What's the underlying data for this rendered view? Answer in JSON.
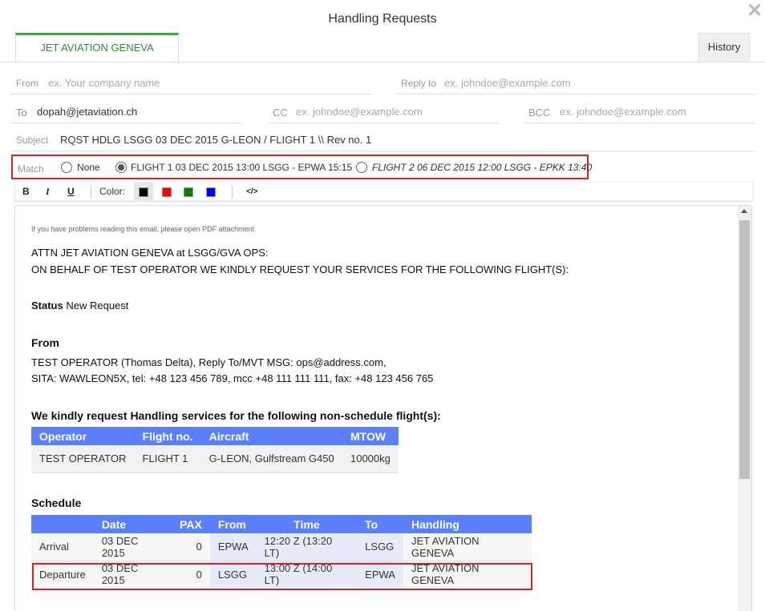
{
  "window": {
    "title": "Handling Requests"
  },
  "tabs": {
    "active": "JET AVIATION GENEVA",
    "history": "History"
  },
  "form": {
    "from_label": "From",
    "from_placeholder": "ex. Your company name",
    "reply_label": "Reply to",
    "reply_placeholder": "ex. johndoe@example.com",
    "to_label": "To",
    "to_value": "dopah@jetaviation.ch",
    "cc_label": "CC",
    "cc_placeholder": "ex. johndoe@example.com",
    "bcc_label": "BCC",
    "bcc_placeholder": "ex. johndoe@example.com",
    "subject_label": "Subject",
    "subject_value": "RQST HDLG  LSGG 03 DEC 2015  G-LEON / FLIGHT 1 \\\\ Rev no. 1"
  },
  "match": {
    "label": "Match",
    "options": [
      {
        "label": "None",
        "selected": false
      },
      {
        "label": "FLIGHT 1 03 DEC 2015 13:00 LSGG - EPWA 15:15",
        "selected": true
      },
      {
        "label": "FLIGHT 2 06 DEC 2015 12:00 LSGG - EPKK 13:40",
        "selected": false
      }
    ]
  },
  "toolbar": {
    "bold": "B",
    "italic": "I",
    "underline": "U",
    "color_label": "Color:",
    "colors": [
      "#000000",
      "#ff0000",
      "#008000",
      "#0000ff"
    ],
    "code": "</>"
  },
  "email": {
    "note": "If you have problems reading this email, please open PDF attachment",
    "attn1": "ATTN JET AVIATION GENEVA at LSGG/GVA OPS:",
    "attn2": "ON BEHALF OF TEST OPERATOR WE KINDLY REQUEST YOUR SERVICES FOR THE FOLLOWING FLIGHT(S):",
    "status_label": "Status",
    "status_value": "New Request",
    "from_heading": "From",
    "from_line1": "TEST OPERATOR (Thomas Delta), Reply To/MVT MSG: ops@address.com,",
    "from_line2": "SITA: WAWLEON5X,  tel: +48 123 456 789, mcc +48 111 111 111,  fax: +48 123 456 765",
    "request_heading": "We kindly request Handling services for the following non-schedule flight(s):",
    "flight_table": {
      "headers": [
        "Operator",
        "Flight no.",
        "Aircraft",
        "MTOW"
      ],
      "row": [
        "TEST OPERATOR",
        "FLIGHT 1",
        "G-LEON, Gulfstream G450",
        "10000kg"
      ]
    },
    "schedule_heading": "Schedule",
    "schedule_table": {
      "headers": [
        "",
        "Date",
        "PAX",
        "From",
        "Time",
        "To",
        "Handling"
      ],
      "rows": [
        [
          "Arrival",
          "03 DEC 2015",
          "0",
          "EPWA",
          "12:20 Z (13:20 LT)",
          "LSGG",
          "JET AVIATION GENEVA"
        ],
        [
          "Departure",
          "03 DEC 2015",
          "0",
          "LSGG",
          "13:00 Z (14:00 LT)",
          "EPWA",
          "JET AVIATION GENEVA"
        ]
      ]
    }
  }
}
